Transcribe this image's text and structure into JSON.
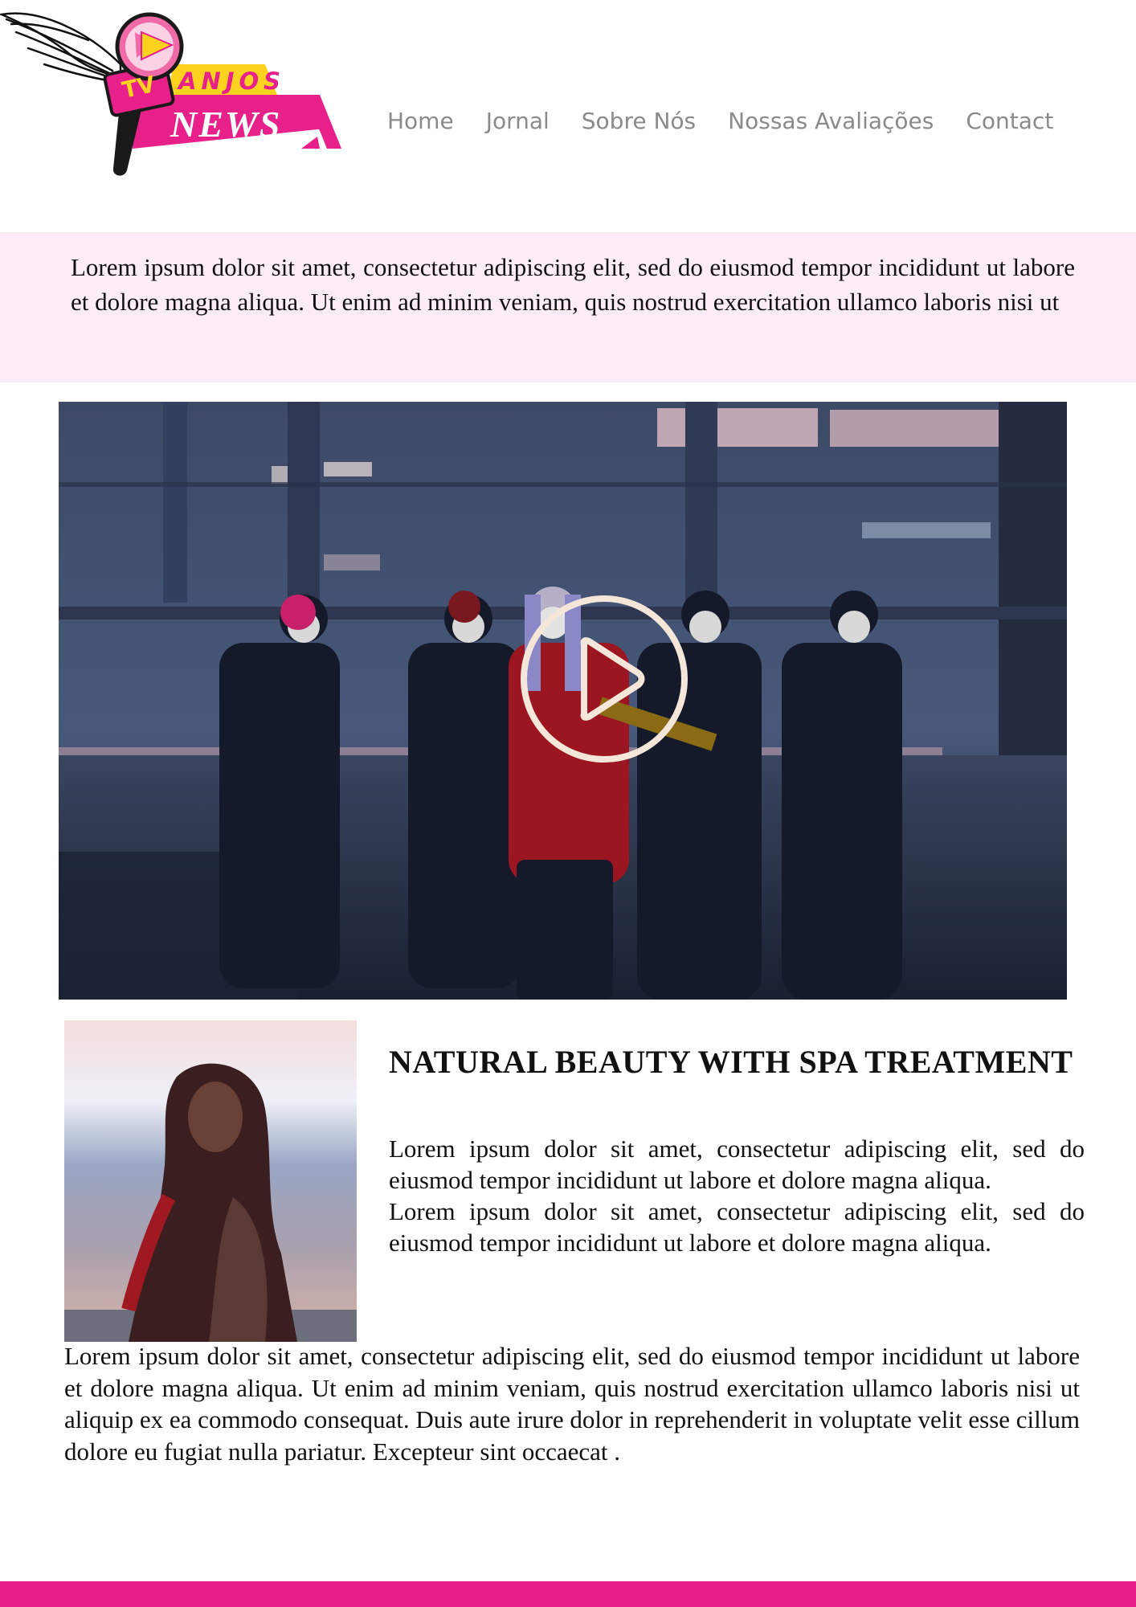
{
  "logo": {
    "tv": "TV",
    "anjos": "ANJOS",
    "news": "NEWS"
  },
  "nav": {
    "items": [
      "Home",
      "Jornal",
      "Sobre Nós",
      "Nossas Avaliações",
      "Contact"
    ]
  },
  "intro": {
    "text": "Lorem ipsum dolor sit amet, consectetur adipiscing elit, sed do eiusmod tempor incididunt ut labore et dolore magna aliqua. Ut enim ad minim veniam, quis nostrud exercitation ullamco laboris nisi ut"
  },
  "video": {
    "play_icon": "play-circle-icon"
  },
  "article": {
    "title": "NATURAL BEAUTY WITH SPA TREATMENT",
    "paragraphs": [
      "Lorem ipsum dolor sit amet, consectetur adipiscing elit, sed do eiusmod tempor incididunt ut labore et dolore magna aliqua.",
      "Lorem ipsum dolor sit amet, consectetur adipiscing elit, sed do eiusmod tempor incididunt ut labore et dolore magna aliqua."
    ],
    "body": "Lorem ipsum dolor sit amet, consectetur adipiscing elit, sed do eiusmod tempor incididunt ut labore et dolore magna aliqua. Ut enim ad minim veniam, quis nostrud exercitation ullamco laboris nisi ut aliquip ex ea commodo consequat. Duis aute irure dolor in reprehenderit in voluptate velit esse cillum dolore eu fugiat nulla pariatur. Excepteur sint occaecat ."
  },
  "colors": {
    "brand_pink": "#e91e8c",
    "brand_yellow": "#ffd21f",
    "intro_background": "#fcecf6",
    "nav_text": "#8a8a8a"
  }
}
